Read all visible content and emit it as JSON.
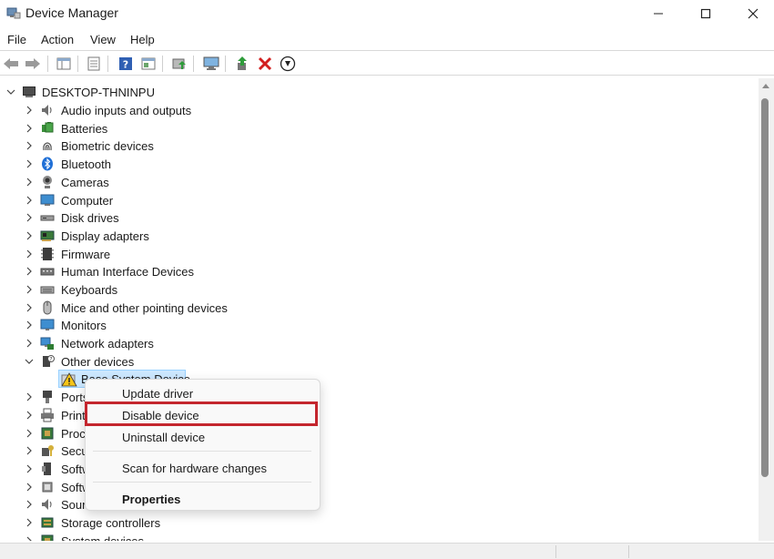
{
  "window": {
    "title": "Device Manager",
    "minimize_glyph": "–",
    "maximize_glyph": "☐",
    "close_glyph": "✕"
  },
  "menu": {
    "items": [
      "File",
      "Action",
      "View",
      "Help"
    ]
  },
  "toolbar": {
    "buttons": [
      "back-icon",
      "forward-icon",
      "show-hide-console-tree-icon",
      "properties-icon",
      "help-icon",
      "view-icon",
      "update-driver-icon",
      "scan-hardware-icon",
      "enable-device-icon",
      "uninstall-icon",
      "disable-device-icon"
    ]
  },
  "tree": {
    "root": "DESKTOP-THNINPU",
    "nodes": [
      {
        "label": "Audio inputs and outputs",
        "icon": "speaker-icon"
      },
      {
        "label": "Batteries",
        "icon": "battery-icon"
      },
      {
        "label": "Biometric devices",
        "icon": "fingerprint-icon"
      },
      {
        "label": "Bluetooth",
        "icon": "bluetooth-icon"
      },
      {
        "label": "Cameras",
        "icon": "camera-icon"
      },
      {
        "label": "Computer",
        "icon": "computer-icon"
      },
      {
        "label": "Disk drives",
        "icon": "disk-drive-icon"
      },
      {
        "label": "Display adapters",
        "icon": "display-adapter-icon"
      },
      {
        "label": "Firmware",
        "icon": "firmware-icon"
      },
      {
        "label": "Human Interface Devices",
        "icon": "hid-icon"
      },
      {
        "label": "Keyboards",
        "icon": "keyboard-icon"
      },
      {
        "label": "Mice and other pointing devices",
        "icon": "mouse-icon"
      },
      {
        "label": "Monitors",
        "icon": "monitor-icon"
      },
      {
        "label": "Network adapters",
        "icon": "network-icon"
      },
      {
        "label": "Other devices",
        "icon": "other-devices-icon"
      }
    ],
    "selected_child": "Base System Device",
    "truncated_nodes": [
      "Ports",
      "Print",
      "Proc",
      "Secu",
      "Softw",
      "Softw",
      "Sour"
    ],
    "after_nodes": [
      {
        "label": "Storage controllers",
        "icon": "storage-controller-icon"
      },
      {
        "label": "System devices",
        "icon": "system-devices-icon"
      }
    ]
  },
  "context_menu": {
    "items": [
      "Update driver",
      "Disable device",
      "Uninstall device"
    ],
    "scan": "Scan for hardware changes",
    "properties": "Properties",
    "highlighted": "Disable device"
  },
  "colors": {
    "highlight_box": "#c4262e",
    "selection_bg": "#cce8ff",
    "bluetooth_blue": "#1f6fd6"
  }
}
